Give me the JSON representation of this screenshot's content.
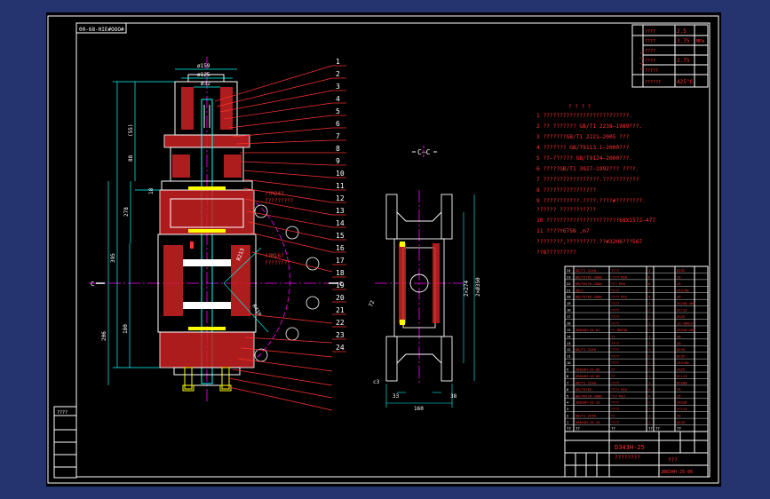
{
  "drawing_code": "00-68-HIE#OOO#",
  "section_label": "C—C",
  "cc_mark_left": "C",
  "cc_mark_right": "C",
  "tech_title": "? ? ? ?",
  "params": [
    {
      "label": "????",
      "value": "2.5",
      "unit": ""
    },
    {
      "label": "????",
      "value": "3.75",
      "unit": "MPa"
    },
    {
      "label": "????",
      "value": "",
      "unit": ""
    },
    {
      "label": "????",
      "value": "2.75",
      "unit": ""
    },
    {
      "label": "?????",
      "value": "",
      "unit": ""
    },
    {
      "label": "??????",
      "value": "425°C",
      "unit": ""
    }
  ],
  "params_side": "? ? ? ?",
  "notes": [
    "1  ??????????????????????????.",
    "2  ?? ??????? GB/T1 2238—1989???.",
    "3  ???????GB/T1 2221—2005 ???",
    "4  ??????? GB/T9113.1—2000???",
    "5  ??—?????? GB/T9124—2000???.",
    "6  ?????GB/T1 3927—1992??? ????.",
    "7  ?????????????????.???????????",
    "8  ????????????????",
    "9  ???????????.????.????#????????.",
    "   ?????? ???????????",
    "10  ??????????????????????68X1572—477",
    "11  ????Y675N ,m7",
    "   ????????,?????????.??#32H8???567",
    "   ??8?????????"
  ],
  "callouts": [
    "1",
    "2",
    "3",
    "4",
    "5",
    "6",
    "7",
    "8",
    "9",
    "10",
    "11",
    "12",
    "13",
    "14",
    "15",
    "16",
    "17",
    "18",
    "19",
    "20",
    "21",
    "22",
    "23",
    "24"
  ],
  "dims_main": {
    "d1": "ø159",
    "d2": "ø125",
    "d3": "ø32",
    "h1": "(55)",
    "h2": "88",
    "h3": "278",
    "h4": "18",
    "h5": "395",
    "h6": "180",
    "h7": "206",
    "r1": "R213",
    "r2": "R410"
  },
  "dims_side": {
    "h1": "2×274",
    "h2": "2×Ø350",
    "w1": "c3",
    "w2": "33",
    "w3": "38",
    "w4": "160",
    "a1": "72"
  },
  "labels_red": [
    "??M24?",
    "?????????",
    "??M16?",
    "????????"
  ],
  "parts_rows": [
    [
      "24",
      "GB/T1 2240—",
      "????",
      "1",
      "",
      "Q235"
    ],
    [
      "23",
      "GB/T5781-2000",
      "???? M16",
      "8",
      "",
      "35"
    ],
    [
      "22",
      "GB/T6170-2000",
      "??? M16",
      "8",
      "",
      "25"
    ],
    [
      "21",
      "JB/T",
      "????",
      "1",
      "",
      "35CrMo"
    ],
    [
      "20",
      "GB/T5783-2000",
      "???? M12",
      "4",
      "",
      "35"
    ],
    [
      "19",
      "",
      "????",
      "1",
      "",
      "ZG230-450"
    ],
    [
      "18",
      "",
      "????",
      "1",
      "",
      "2Cr13"
    ],
    [
      "17",
      "",
      "????",
      "1",
      "",
      "ZG25"
    ],
    [
      "16",
      "",
      "????",
      "1",
      "",
      "1Cr18Ni9"
    ],
    [
      "15",
      "2B834H-25-01",
      "?? DN250",
      "1",
      "",
      "ZG230-450"
    ],
    [
      "14",
      "",
      "??",
      "1",
      "",
      "45"
    ],
    [
      "13",
      "",
      "????",
      "1",
      "",
      "20"
    ],
    [
      "12",
      "GB/T1 2240",
      "????",
      "1",
      "",
      "Q235"
    ],
    [
      "11",
      "",
      "????",
      "2",
      "",
      "Q235"
    ],
    [
      "10",
      "",
      "????",
      "1",
      "",
      "35CrMo"
    ],
    [
      "9",
      "2B834H-25-05",
      "??",
      "1",
      "",
      "ZG25"
    ],
    [
      "8",
      "2B834H-25-09",
      "??",
      "1",
      "",
      "2Cr13"
    ],
    [
      "7",
      "GB/T1 2240-",
      "????",
      "1",
      "",
      "HT200"
    ],
    [
      "6",
      "GB/T5782-",
      "???? M12",
      "4",
      "",
      "35"
    ],
    [
      "5",
      "GB/T6170-2000",
      "??? M12",
      "4",
      "",
      "25"
    ],
    [
      "4",
      "2B834H-25-12",
      "????",
      "1",
      "",
      "ZG230"
    ],
    [
      "3",
      "",
      "????",
      "1",
      "",
      "2Cr13"
    ],
    [
      "2",
      "GB/T1 2240",
      "??",
      "1",
      "",
      "35"
    ],
    [
      "1",
      "2B834H-25-14",
      "????",
      "1",
      "",
      "Q235"
    ]
  ],
  "parts_header": [
    "??",
    "??",
    "??",
    "??",
    "??",
    "??"
  ],
  "title_block": {
    "model": "D343H-25",
    "name": "????????",
    "quantity": "???",
    "sheet_code": "2B834H-25-00"
  },
  "left_strip": [
    "????",
    "",
    "",
    "",
    "",
    ""
  ]
}
